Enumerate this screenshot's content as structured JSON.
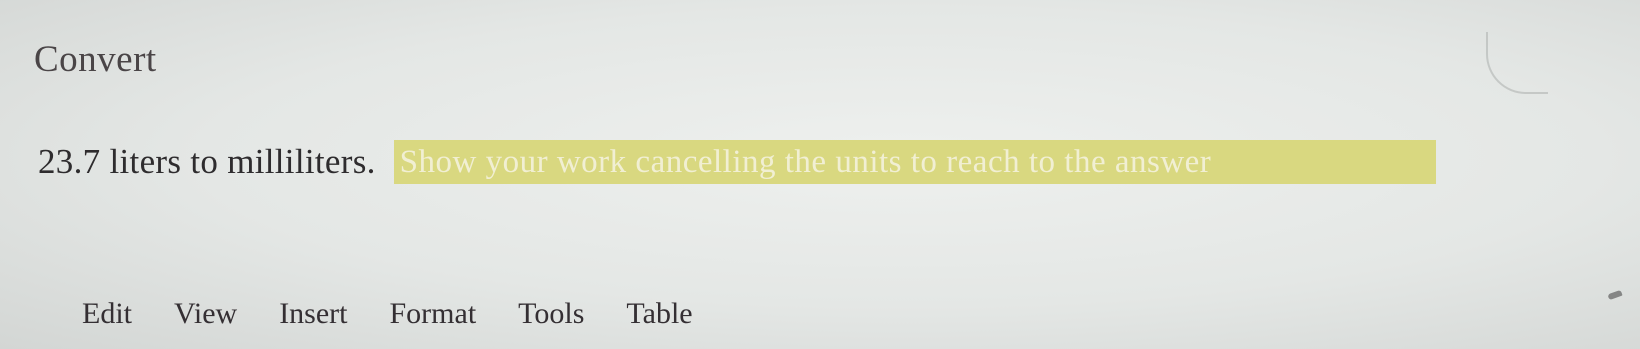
{
  "question": {
    "title": "Convert",
    "prompt": "23.7 liters to milliliters.",
    "instruction": "Show your work cancelling the units to reach to the answer"
  },
  "colors": {
    "background": "#e4e7e5",
    "highlight": "#d9d880",
    "highlight_text": "#f1efd3",
    "text": "#2e2c2e"
  },
  "editor": {
    "menu": [
      "Edit",
      "View",
      "Insert",
      "Format",
      "Tools",
      "Table"
    ]
  }
}
